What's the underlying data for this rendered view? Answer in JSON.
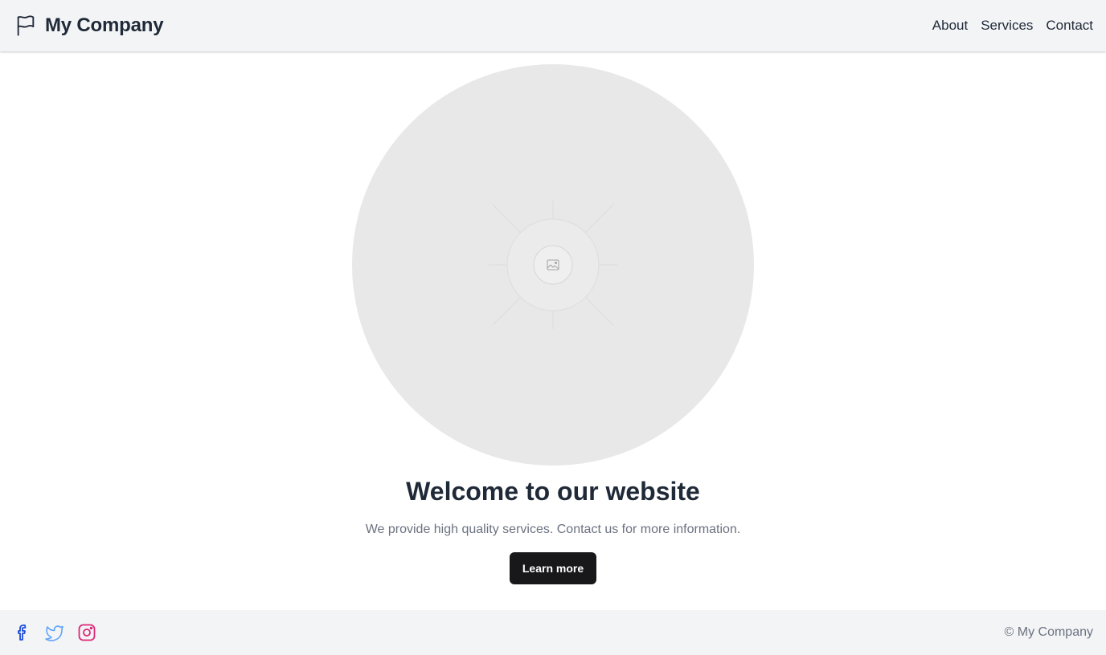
{
  "header": {
    "brand_name": "My Company",
    "brand_icon": "flag-icon",
    "nav": [
      {
        "label": "About"
      },
      {
        "label": "Services"
      },
      {
        "label": "Contact"
      }
    ]
  },
  "hero": {
    "image_icon": "image-placeholder-icon",
    "headline": "Welcome to our website",
    "subtext": "We provide high quality services. Contact us for more information.",
    "cta_label": "Learn more"
  },
  "footer": {
    "socials": [
      {
        "icon": "facebook-icon",
        "color": "#1d4ed8"
      },
      {
        "icon": "twitter-icon",
        "color": "#60a5fa"
      },
      {
        "icon": "instagram-icon",
        "color": "#db2777"
      }
    ],
    "copyright": "© My Company"
  },
  "colors": {
    "header_bg": "#f3f4f6",
    "text_primary": "#1f2937",
    "text_muted": "#6b7280",
    "button_bg": "#18181b",
    "placeholder_bg": "#e8e8e8"
  }
}
